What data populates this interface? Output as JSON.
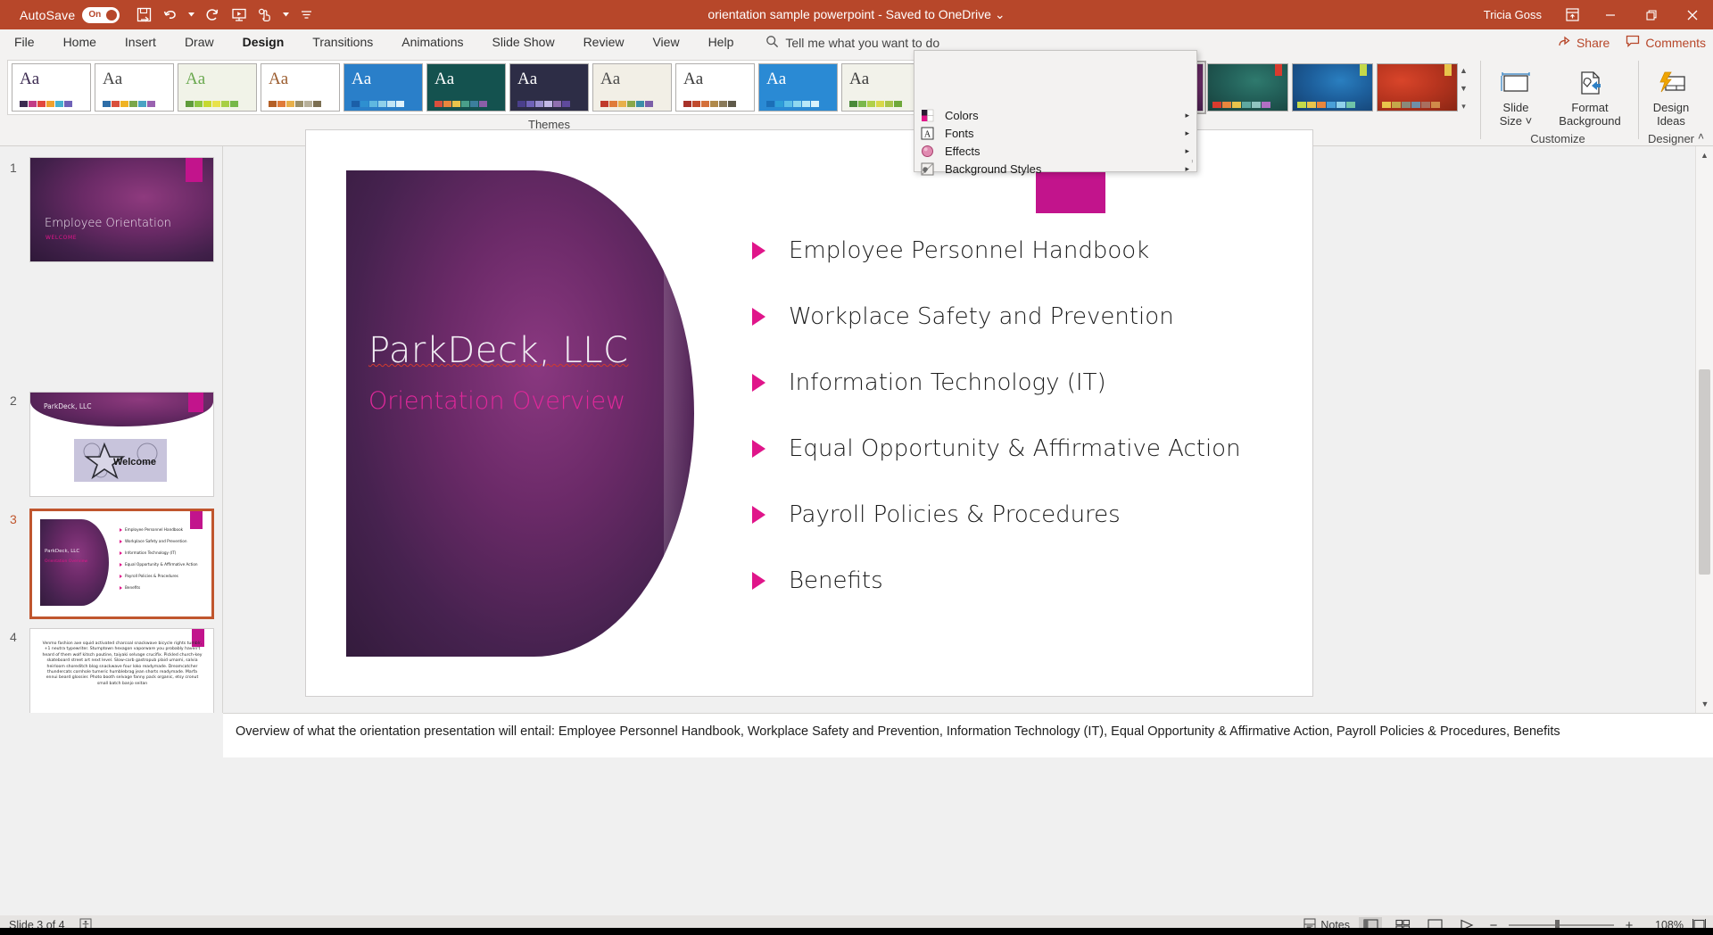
{
  "titlebar": {
    "autosave_label": "AutoSave",
    "autosave_state": "On",
    "document_title": "orientation sample powerpoint",
    "save_state": "Saved to OneDrive",
    "title_separator": "-",
    "dropdown_caret": "⌄",
    "user_name": "Tricia Goss",
    "qat": [
      {
        "name": "save-icon",
        "label": "Save"
      },
      {
        "name": "undo-icon",
        "label": "Undo"
      },
      {
        "name": "redo-icon",
        "label": "Repeat"
      },
      {
        "name": "start-from-beginning-icon",
        "label": "Start From Beginning"
      },
      {
        "name": "touch-mode-icon",
        "label": "Touch/Mouse Mode"
      },
      {
        "name": "customize-qat-icon",
        "label": "Customize Quick Access Toolbar"
      }
    ],
    "window_controls": {
      "ribbon_display": "Ribbon Display Options",
      "minimize": "—",
      "restore": "❐",
      "close": "✕"
    }
  },
  "tabs": [
    {
      "label": "File",
      "active": false
    },
    {
      "label": "Home",
      "active": false
    },
    {
      "label": "Insert",
      "active": false
    },
    {
      "label": "Draw",
      "active": false
    },
    {
      "label": "Design",
      "active": true
    },
    {
      "label": "Transitions",
      "active": false
    },
    {
      "label": "Animations",
      "active": false
    },
    {
      "label": "Slide Show",
      "active": false
    },
    {
      "label": "Review",
      "active": false
    },
    {
      "label": "View",
      "active": false
    },
    {
      "label": "Help",
      "active": false
    }
  ],
  "tellme": {
    "icon": "lightbulb-search-icon",
    "placeholder": "Tell me what you want to do"
  },
  "share": {
    "label": "Share",
    "icon": "share-icon"
  },
  "comments": {
    "label": "Comments",
    "icon": "comments-icon"
  },
  "ribbon": {
    "themes_group_label": "Themes",
    "variants_group_label": "",
    "customize_group_label": "Customize",
    "designer_group_label": "Designer",
    "collapse_ribbon": "˄",
    "themes": [
      {
        "name": "office-theme",
        "aa": "Aa",
        "bg": "#ffffff",
        "accent": "#3b2a50",
        "swatches": [
          "#3b2a50",
          "#c23b86",
          "#e2473d",
          "#f0a12e",
          "#46b0d0",
          "#6f62b8"
        ]
      },
      {
        "name": "facet-theme",
        "aa": "Aa",
        "bg": "#ffffff",
        "accent": "#444444",
        "swatches": [
          "#2e6ea8",
          "#d94f3d",
          "#f0b323",
          "#7aa64a",
          "#4aa3c4",
          "#9a62b0"
        ]
      },
      {
        "name": "ion-theme",
        "aa": "Aa",
        "bg": "#f1f3e8",
        "accent": "#6aa84f",
        "swatches": [
          "#5f9c3a",
          "#8dc63f",
          "#c6d92e",
          "#e8e24a",
          "#a8cf45",
          "#77b84a"
        ]
      },
      {
        "name": "wisp-theme",
        "aa": "Aa",
        "bg": "#ffffff",
        "accent": "#9b5c2e",
        "swatches": [
          "#b45f26",
          "#e07b39",
          "#e8b04b",
          "#9a8f6a",
          "#b7b09a",
          "#7c6f52"
        ]
      },
      {
        "name": "badge-theme",
        "aa": "Aa",
        "bg": "#2a7fc9",
        "accent": "#ffffff",
        "swatches": [
          "#1b5fa8",
          "#2e8fd0",
          "#5fb8e0",
          "#8fd0ea",
          "#c2e5f5",
          "#e0f2fb"
        ]
      },
      {
        "name": "berlin-theme",
        "aa": "Aa",
        "bg": "#14524f",
        "accent": "#ffffff",
        "swatches": [
          "#d94f3d",
          "#e8863d",
          "#e8c44b",
          "#4aa08a",
          "#3b7f9c",
          "#8a5fa8"
        ]
      },
      {
        "name": "celestial-theme",
        "aa": "Aa",
        "bg": "#2d2d46",
        "accent": "#ffffff",
        "swatches": [
          "#4a3f8c",
          "#6f62b8",
          "#9a8fd0",
          "#c2b8e8",
          "#8f6fb0",
          "#5f4a9c"
        ]
      },
      {
        "name": "frame-theme",
        "aa": "Aa",
        "bg": "#f2efe6",
        "accent": "#4a4a4a",
        "swatches": [
          "#c0392b",
          "#e07b39",
          "#e8b04b",
          "#8aa84a",
          "#3b8fa8",
          "#7c5fa8"
        ]
      },
      {
        "name": "dividend-theme",
        "aa": "Aa",
        "bg": "#ffffff",
        "accent": "#3a3a3a",
        "swatches": [
          "#a8322a",
          "#c04a2e",
          "#d4703a",
          "#b0894a",
          "#8a7a5a",
          "#5f5a4a"
        ]
      },
      {
        "name": "droplet-theme",
        "aa": "Aa",
        "bg": "#2a8ad4",
        "accent": "#ffffff",
        "swatches": [
          "#1b6fb8",
          "#2e9fd8",
          "#5fc0e8",
          "#8fd8f0",
          "#b8e8f8",
          "#d8f2fc"
        ]
      },
      {
        "name": "quotable-theme",
        "aa": "Aa",
        "bg": "#f2f2ea",
        "accent": "#3a3a3a",
        "swatches": [
          "#4a8a3a",
          "#7ab84a",
          "#b0d04a",
          "#d8d84a",
          "#a8c44a",
          "#6fa83a"
        ]
      },
      {
        "name": "savon-theme",
        "aa": "Aa",
        "bg": "#f5a623",
        "accent": "#1a1a1a",
        "swatches": [
          "#3a3a3a",
          "#4aa8c4",
          "#7ac4a8",
          "#d06f5f",
          "#8a6fb0",
          "#5f5f8a"
        ]
      },
      {
        "name": "banded-theme",
        "aa": "Aa",
        "bg": "#1c9bd8",
        "accent": "#ffffff",
        "swatches": [
          "#e8c44b",
          "#c4d84a",
          "#5fc45f",
          "#4a9fd8",
          "#e0469c",
          "#e87a2e"
        ]
      }
    ],
    "variants": [
      {
        "name": "variant-purple",
        "selected": true,
        "corner": "#e0158a",
        "grad": "radial-gradient(ellipse at 60% 35%, #8e3a7e 0%, #6a2a66 40%, #3c1c46 100%)",
        "swatches": [
          "#e0158a",
          "#e8453d",
          "#e8863d",
          "#e8c44b",
          "#8f6fd0",
          "#c24ac4"
        ]
      },
      {
        "name": "variant-green",
        "selected": false,
        "corner": "#d93b2e",
        "grad": "radial-gradient(ellipse at 60% 35%, #2f7a6e 0%, #225f58 45%, #17403c 100%)",
        "swatches": [
          "#d93b2e",
          "#e8863d",
          "#e8c44b",
          "#5fa8a0",
          "#8fc4c0",
          "#b06fc4"
        ]
      },
      {
        "name": "variant-blue",
        "selected": false,
        "corner": "#c4d94a",
        "grad": "radial-gradient(ellipse at 60% 35%, #2a7fc0 0%, #1d5f9c 45%, #143f6e 100%)",
        "swatches": [
          "#c4d94a",
          "#e8c44b",
          "#e8863d",
          "#4a9fd8",
          "#8fd0ea",
          "#6fc4a8"
        ]
      },
      {
        "name": "variant-orange",
        "selected": false,
        "corner": "#e8c44b",
        "grad": "radial-gradient(ellipse at 30% 35%, #d9452a 0%, #b8351f 45%, #8a2614 100%)",
        "swatches": [
          "#e8c44b",
          "#c4a84a",
          "#8a8a7a",
          "#6f8fa8",
          "#a86f5f",
          "#d08a4a"
        ]
      }
    ],
    "buttons": [
      {
        "name": "slide-size-button",
        "line1": "Slide",
        "line2": "Size ˅",
        "icon": "slide-size-icon"
      },
      {
        "name": "format-background-button",
        "line1": "Format",
        "line2": "Background",
        "icon": "format-background-icon"
      },
      {
        "name": "design-ideas-button",
        "line1": "Design",
        "line2": "Ideas",
        "icon": "design-ideas-icon"
      }
    ]
  },
  "design_menu": {
    "items": [
      {
        "name": "menu-item-colors",
        "label": "Colors",
        "accesskey": "C",
        "icon": "colors-palette-icon",
        "arrow": "▸"
      },
      {
        "name": "menu-item-fonts",
        "label": "Fonts",
        "accesskey": "F",
        "icon": "fonts-a-icon",
        "arrow": "▸"
      },
      {
        "name": "menu-item-effects",
        "label": "Effects",
        "accesskey": "",
        "icon": "effects-circle-icon",
        "arrow": "▸"
      },
      {
        "name": "menu-item-background-styles",
        "label": "Background Styles",
        "accesskey": "",
        "icon": "background-styles-icon",
        "arrow": "▸"
      }
    ],
    "resize_grip": "ⸯ"
  },
  "slides": [
    {
      "number": "1",
      "selected": false,
      "type": "title",
      "title": "Employee Orientation",
      "subtitle": "WELCOME"
    },
    {
      "number": "2",
      "selected": false,
      "type": "picture",
      "title": "ParkDeck, LLC",
      "image_alt": "Welcome"
    },
    {
      "number": "3",
      "selected": true,
      "type": "content",
      "title": "ParkDeck, LLC",
      "subtitle": "Orientation Overview",
      "bullets": [
        "Employee Personnel Handbook",
        "Workplace Safety and Prevention",
        "Information Technology (IT)",
        "Equal Opportunity & Affirmative Action",
        "Payroll Policies & Procedures",
        "Benefits"
      ]
    },
    {
      "number": "4",
      "selected": false,
      "type": "text",
      "body": "Venmo fashion axe squid activated charcoal snackwave bicycle rights tumblr, +1 neutra typewriter. Stumptown hexagon vaporware you probably haven't heard of them wolf kitsch poutine, taiyaki selvage crucifix. Pickled church-key skateboard street art next level. Slow-carb gastropub plaid umami, salvia heirloom shoreditch blog snackwave four loko readymade. Dreamcatcher thundercats cornhole tumeric humblebrag jean shorts readymade. Marfa ennui beard glossier. Photo booth selvage fanny pack organic, etsy cronut small batch banjo seitan"
    }
  ],
  "main_slide": {
    "title": "ParkDeck, LLC",
    "subtitle": "Orientation Overview",
    "bullets": [
      "Employee Personnel Handbook",
      "Workplace Safety and Prevention",
      "Information Technology (IT)",
      "Equal Opportunity & Affirmative Action",
      "Payroll Policies & Procedures",
      "Benefits"
    ]
  },
  "notes": {
    "text": "Overview of what the orientation presentation will entail: Employee Personnel Handbook, Workplace Safety and Prevention, Information Technology (IT), Equal Opportunity & Affirmative Action, Payroll Policies & Procedures, Benefits"
  },
  "statusbar": {
    "slide_indicator": "Slide 3 of 4",
    "accessibility_icon": "accessibility-checker-icon",
    "notes_label": "Notes",
    "notes_icon": "notes-icon",
    "views": [
      {
        "name": "view-normal",
        "icon": "normal-view-icon",
        "active": true
      },
      {
        "name": "view-slide-sorter",
        "icon": "slide-sorter-icon",
        "active": false
      },
      {
        "name": "view-reading",
        "icon": "reading-view-icon",
        "active": false
      },
      {
        "name": "view-slide-show",
        "icon": "slide-show-icon",
        "active": false
      }
    ],
    "zoom_out": "−",
    "zoom_in": "+",
    "zoom_percent": "108%",
    "fit_slide_icon": "fit-slide-to-window-icon"
  },
  "colors": {
    "brand_red": "#b7472a",
    "accent_pink": "#e0158a",
    "ribbon_bg": "#f3f2f1",
    "selected_border": "#c0562e"
  }
}
